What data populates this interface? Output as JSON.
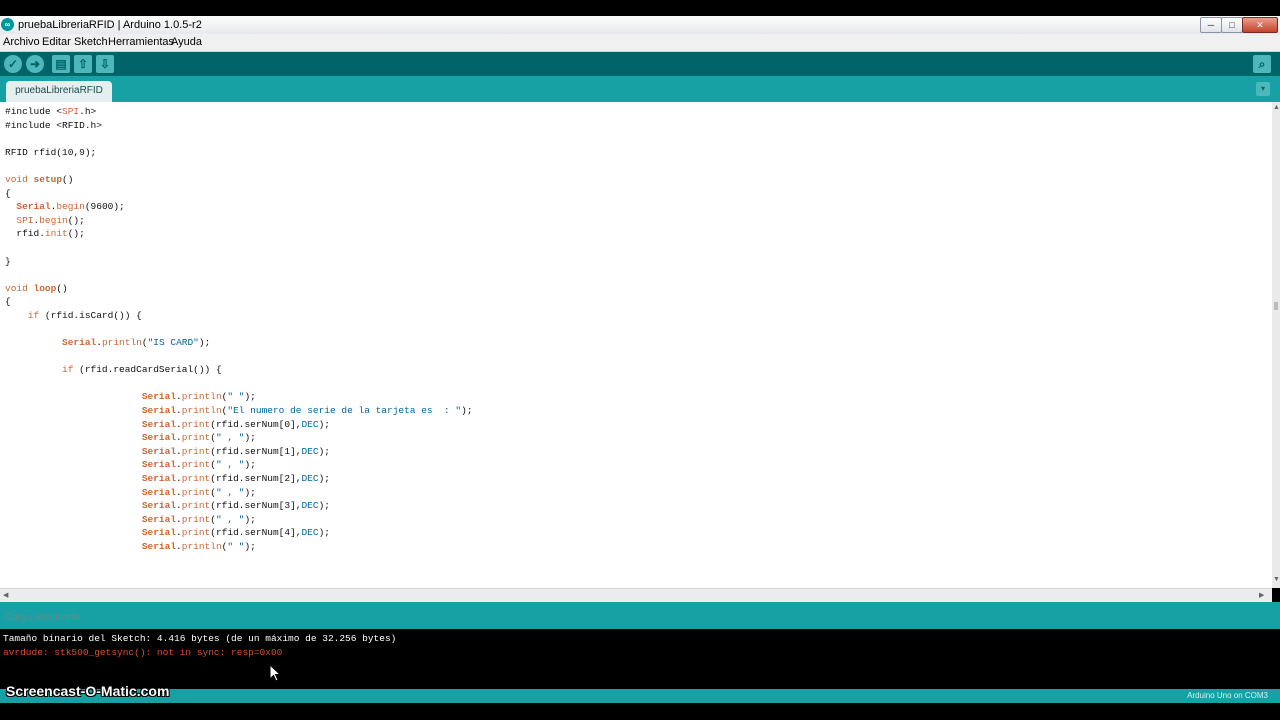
{
  "window": {
    "title": "pruebaLibreriaRFID | Arduino 1.0.5-r2",
    "app_icon": "arduino-icon",
    "controls": {
      "minimize": "─",
      "maximize": "□",
      "close": "✕"
    }
  },
  "menu": [
    "Archivo",
    "Editar",
    "Sketch",
    "Herramientas",
    "Ayuda"
  ],
  "toolbar": {
    "verify": "✓",
    "upload": "➜",
    "new": "▤",
    "open": "⇧",
    "save": "⇩",
    "serial_monitor": "⌕"
  },
  "tabs": {
    "active": "pruebaLibreriaRFID",
    "menu_glyph": "▾"
  },
  "editor": {
    "lines": [
      [
        {
          "t": "#include <"
        },
        {
          "t": "SPI",
          "c": "k"
        },
        {
          "t": ".h>"
        }
      ],
      [
        {
          "t": "#include <RFID.h>"
        }
      ],
      [],
      [
        {
          "t": "RFID rfid(10,9);"
        }
      ],
      [],
      [
        {
          "t": "void ",
          "c": "k"
        },
        {
          "t": "setup",
          "c": "o"
        },
        {
          "t": "()"
        }
      ],
      [
        {
          "t": "{"
        }
      ],
      [
        {
          "t": "  "
        },
        {
          "t": "Serial",
          "c": "o"
        },
        {
          "t": "."
        },
        {
          "t": "begin",
          "c": "k"
        },
        {
          "t": "(9600);"
        }
      ],
      [
        {
          "t": "  "
        },
        {
          "t": "SPI",
          "c": "k"
        },
        {
          "t": "."
        },
        {
          "t": "begin",
          "c": "k"
        },
        {
          "t": "();"
        }
      ],
      [
        {
          "t": "  rfid."
        },
        {
          "t": "init",
          "c": "k"
        },
        {
          "t": "();"
        }
      ],
      [],
      [
        {
          "t": "}"
        }
      ],
      [],
      [
        {
          "t": "void ",
          "c": "k"
        },
        {
          "t": "loop",
          "c": "o"
        },
        {
          "t": "()"
        }
      ],
      [
        {
          "t": "{"
        }
      ],
      [
        {
          "t": "    "
        },
        {
          "t": "if",
          "c": "k"
        },
        {
          "t": " (rfid.isCard()) {"
        }
      ],
      [],
      [
        {
          "t": "          "
        },
        {
          "t": "Serial",
          "c": "o"
        },
        {
          "t": "."
        },
        {
          "t": "println",
          "c": "k"
        },
        {
          "t": "("
        },
        {
          "t": "\"IS CARD\"",
          "c": "c"
        },
        {
          "t": ");"
        }
      ],
      [],
      [
        {
          "t": "          "
        },
        {
          "t": "if",
          "c": "k"
        },
        {
          "t": " (rfid.readCardSerial()) {"
        }
      ],
      [],
      [
        {
          "t": "                        "
        },
        {
          "t": "Serial",
          "c": "o"
        },
        {
          "t": "."
        },
        {
          "t": "println",
          "c": "k"
        },
        {
          "t": "("
        },
        {
          "t": "\" \"",
          "c": "c"
        },
        {
          "t": ");"
        }
      ],
      [
        {
          "t": "                        "
        },
        {
          "t": "Serial",
          "c": "o"
        },
        {
          "t": "."
        },
        {
          "t": "println",
          "c": "k"
        },
        {
          "t": "("
        },
        {
          "t": "\"El numero de serie de la tarjeta es  : \"",
          "c": "c"
        },
        {
          "t": ");"
        }
      ],
      [
        {
          "t": "                        "
        },
        {
          "t": "Serial",
          "c": "o"
        },
        {
          "t": "."
        },
        {
          "t": "print",
          "c": "k"
        },
        {
          "t": "(rfid.serNum[0],"
        },
        {
          "t": "DEC",
          "c": "c"
        },
        {
          "t": ");"
        }
      ],
      [
        {
          "t": "                        "
        },
        {
          "t": "Serial",
          "c": "o"
        },
        {
          "t": "."
        },
        {
          "t": "print",
          "c": "k"
        },
        {
          "t": "("
        },
        {
          "t": "\" , \"",
          "c": "c"
        },
        {
          "t": ");"
        }
      ],
      [
        {
          "t": "                        "
        },
        {
          "t": "Serial",
          "c": "o"
        },
        {
          "t": "."
        },
        {
          "t": "print",
          "c": "k"
        },
        {
          "t": "(rfid.serNum[1],"
        },
        {
          "t": "DEC",
          "c": "c"
        },
        {
          "t": ");"
        }
      ],
      [
        {
          "t": "                        "
        },
        {
          "t": "Serial",
          "c": "o"
        },
        {
          "t": "."
        },
        {
          "t": "print",
          "c": "k"
        },
        {
          "t": "("
        },
        {
          "t": "\" , \"",
          "c": "c"
        },
        {
          "t": ");"
        }
      ],
      [
        {
          "t": "                        "
        },
        {
          "t": "Serial",
          "c": "o"
        },
        {
          "t": "."
        },
        {
          "t": "print",
          "c": "k"
        },
        {
          "t": "(rfid.serNum[2],"
        },
        {
          "t": "DEC",
          "c": "c"
        },
        {
          "t": ");"
        }
      ],
      [
        {
          "t": "                        "
        },
        {
          "t": "Serial",
          "c": "o"
        },
        {
          "t": "."
        },
        {
          "t": "print",
          "c": "k"
        },
        {
          "t": "("
        },
        {
          "t": "\" , \"",
          "c": "c"
        },
        {
          "t": ");"
        }
      ],
      [
        {
          "t": "                        "
        },
        {
          "t": "Serial",
          "c": "o"
        },
        {
          "t": "."
        },
        {
          "t": "print",
          "c": "k"
        },
        {
          "t": "(rfid.serNum[3],"
        },
        {
          "t": "DEC",
          "c": "c"
        },
        {
          "t": ");"
        }
      ],
      [
        {
          "t": "                        "
        },
        {
          "t": "Serial",
          "c": "o"
        },
        {
          "t": "."
        },
        {
          "t": "print",
          "c": "k"
        },
        {
          "t": "("
        },
        {
          "t": "\" , \"",
          "c": "c"
        },
        {
          "t": ");"
        }
      ],
      [
        {
          "t": "                        "
        },
        {
          "t": "Serial",
          "c": "o"
        },
        {
          "t": "."
        },
        {
          "t": "print",
          "c": "k"
        },
        {
          "t": "(rfid.serNum[4],"
        },
        {
          "t": "DEC",
          "c": "c"
        },
        {
          "t": ");"
        }
      ],
      [
        {
          "t": "                        "
        },
        {
          "t": "Serial",
          "c": "o"
        },
        {
          "t": "."
        },
        {
          "t": "println",
          "c": "k"
        },
        {
          "t": "("
        },
        {
          "t": "\" \"",
          "c": "c"
        },
        {
          "t": ");"
        }
      ]
    ]
  },
  "status": {
    "message": "Carga terminada."
  },
  "console": {
    "line1": "Tamaño binario del Sketch: 4.416 bytes (de un máximo de 32.256 bytes)",
    "line2": "avrdude: stk500_getsync(): not in sync: resp=0x00"
  },
  "footer": {
    "board": "Arduino Uno on COM3"
  },
  "watermark": "Screencast-O-Matic.com",
  "colors": {
    "toolbar": "#006468",
    "tabbar": "#17a1a5",
    "keyword": "#cc6633",
    "constant": "#006699",
    "error": "#d5532d"
  }
}
